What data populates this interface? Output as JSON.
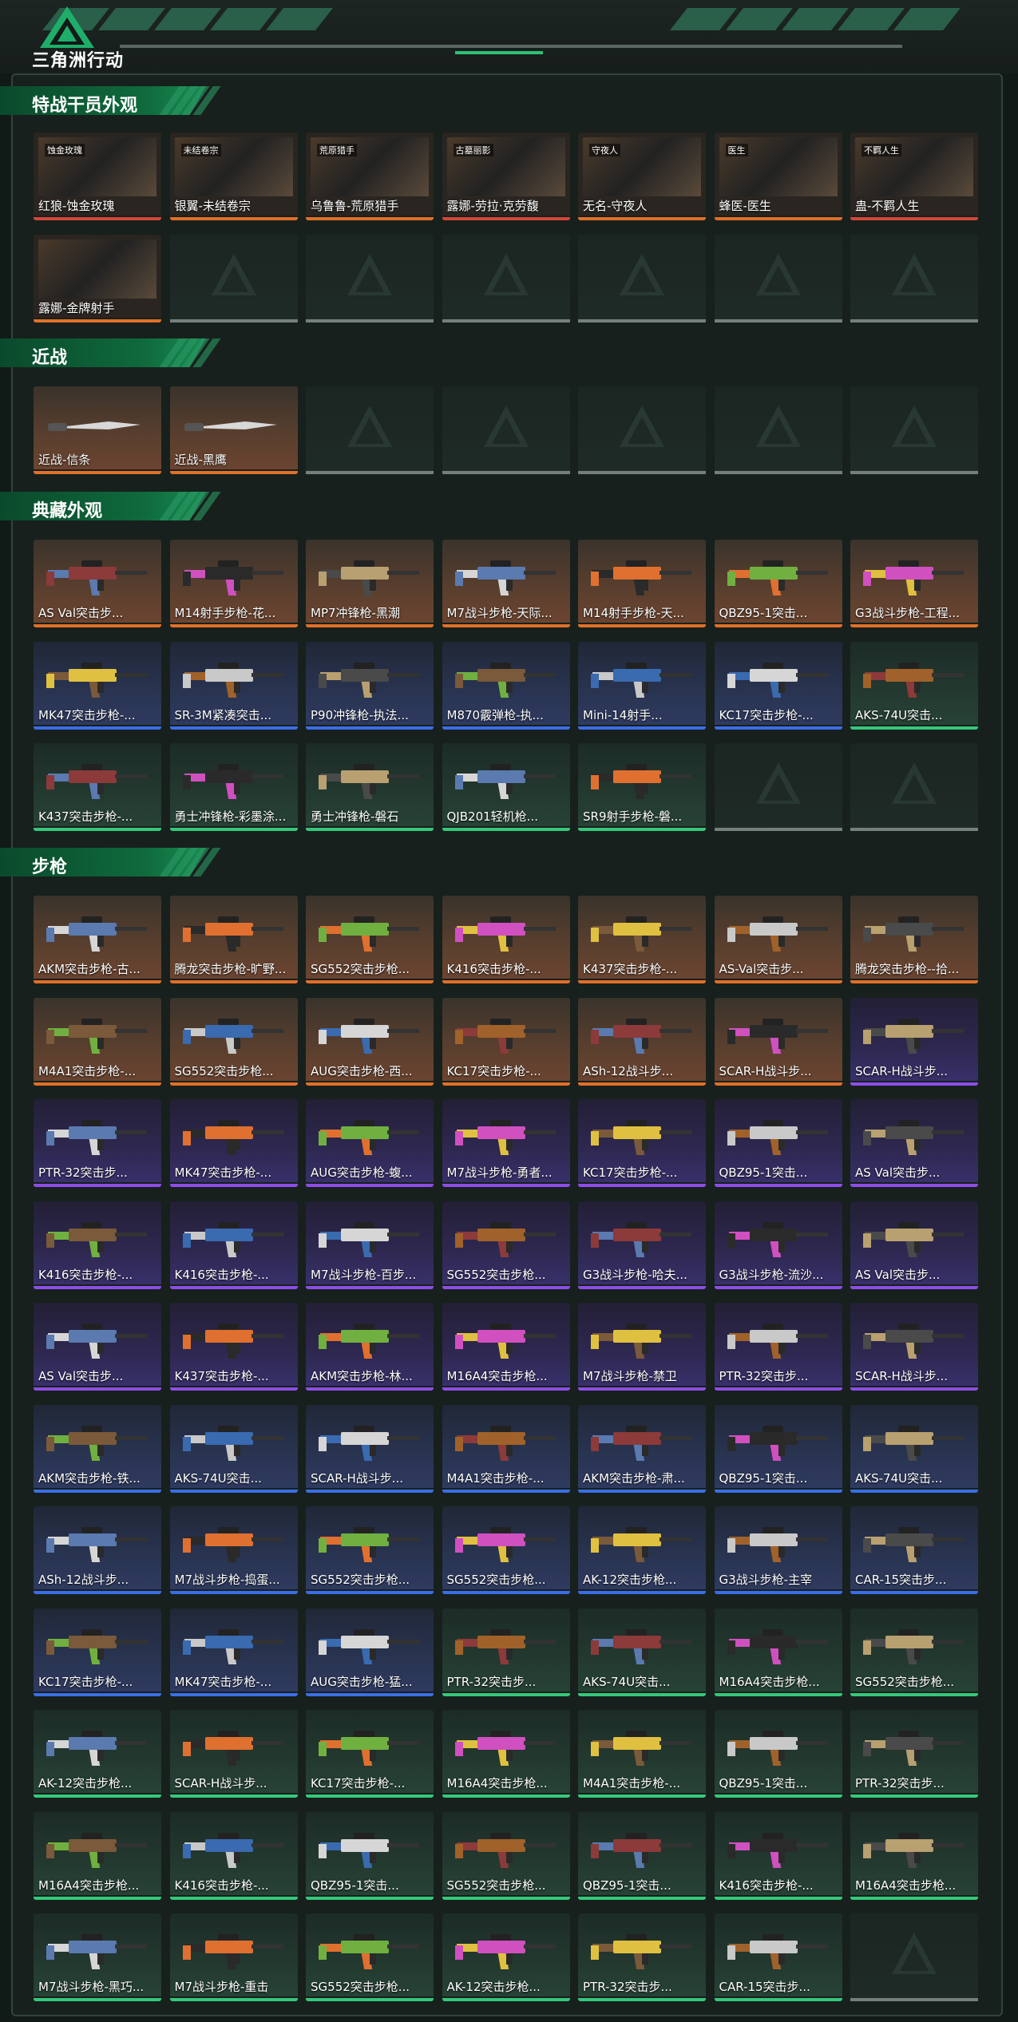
{
  "app": {
    "title": "三角洲行动"
  },
  "sections": [
    {
      "title": "特战干员外观",
      "items": [
        {
          "label": "红狼-蚀金玫瑰",
          "rarity": "red",
          "tag": "蚀金玫瑰"
        },
        {
          "label": "银翼-未结卷宗",
          "rarity": "orange",
          "tag": "未结卷宗"
        },
        {
          "label": "乌鲁鲁-荒原猎手",
          "rarity": "orange",
          "tag": "荒原猎手"
        },
        {
          "label": "露娜-劳拉·克劳馥",
          "rarity": "red",
          "tag": "古墓丽影"
        },
        {
          "label": "无名-守夜人",
          "rarity": "orange",
          "tag": "守夜人"
        },
        {
          "label": "蜂医-医生",
          "rarity": "orange",
          "tag": "医生"
        },
        {
          "label": "蛊-不羁人生",
          "rarity": "red",
          "tag": "不羁人生"
        },
        {
          "label": "露娜-金牌射手",
          "rarity": "orange",
          "tag": ""
        }
      ],
      "empty_slots": 6
    },
    {
      "title": "近战",
      "items": [
        {
          "label": "近战-信条",
          "rarity": "orange"
        },
        {
          "label": "近战-黑鹰",
          "rarity": "orange"
        }
      ],
      "empty_slots": 5
    },
    {
      "title": "典藏外观",
      "items": [
        {
          "label": "AS Val突击步...",
          "rarity": "orange"
        },
        {
          "label": "M14射手步枪-花...",
          "rarity": "orange"
        },
        {
          "label": "MP7冲锋枪-黑潮",
          "rarity": "orange"
        },
        {
          "label": "M7战斗步枪-天际...",
          "rarity": "orange"
        },
        {
          "label": "M14射手步枪-天...",
          "rarity": "orange"
        },
        {
          "label": "QBZ95-1突击...",
          "rarity": "orange"
        },
        {
          "label": "G3战斗步枪-工程...",
          "rarity": "orange"
        },
        {
          "label": "MK47突击步枪-...",
          "rarity": "blue"
        },
        {
          "label": "SR-3M紧凑突击...",
          "rarity": "blue"
        },
        {
          "label": "P90冲锋枪-执法...",
          "rarity": "blue"
        },
        {
          "label": "M870霰弹枪-执...",
          "rarity": "blue"
        },
        {
          "label": "Mini-14射手...",
          "rarity": "blue"
        },
        {
          "label": "KC17突击步枪-...",
          "rarity": "blue"
        },
        {
          "label": "AKS-74U突击...",
          "rarity": "green"
        },
        {
          "label": "K437突击步枪-...",
          "rarity": "green"
        },
        {
          "label": "勇士冲锋枪-彩墨涂...",
          "rarity": "green"
        },
        {
          "label": "勇士冲锋枪-磐石",
          "rarity": "green"
        },
        {
          "label": "QJB201轻机枪...",
          "rarity": "green"
        },
        {
          "label": "SR9射手步枪-磐...",
          "rarity": "green"
        }
      ],
      "empty_slots": 2
    },
    {
      "title": "步枪",
      "items": [
        {
          "label": "AKM突击步枪-古...",
          "rarity": "orange"
        },
        {
          "label": "腾龙突击步枪-旷野...",
          "rarity": "orange"
        },
        {
          "label": "SG552突击步枪...",
          "rarity": "orange"
        },
        {
          "label": "K416突击步枪-...",
          "rarity": "orange"
        },
        {
          "label": "K437突击步枪-...",
          "rarity": "orange"
        },
        {
          "label": "AS-Val突击步...",
          "rarity": "orange"
        },
        {
          "label": "腾龙突击步枪--拾...",
          "rarity": "orange"
        },
        {
          "label": "M4A1突击步枪-...",
          "rarity": "orange"
        },
        {
          "label": "SG552突击步枪...",
          "rarity": "orange"
        },
        {
          "label": "AUG突击步枪-西...",
          "rarity": "orange"
        },
        {
          "label": "KC17突击步枪-...",
          "rarity": "orange"
        },
        {
          "label": "ASh-12战斗步...",
          "rarity": "orange"
        },
        {
          "label": "SCAR-H战斗步...",
          "rarity": "orange"
        },
        {
          "label": "SCAR-H战斗步...",
          "rarity": "purple"
        },
        {
          "label": "PTR-32突击步...",
          "rarity": "purple"
        },
        {
          "label": "MK47突击步枪-...",
          "rarity": "purple"
        },
        {
          "label": "AUG突击步枪-蝮...",
          "rarity": "purple"
        },
        {
          "label": "M7战斗步枪-勇者...",
          "rarity": "purple"
        },
        {
          "label": "KC17突击步枪-...",
          "rarity": "purple"
        },
        {
          "label": "QBZ95-1突击...",
          "rarity": "purple"
        },
        {
          "label": "AS Val突击步...",
          "rarity": "purple"
        },
        {
          "label": "K416突击步枪-...",
          "rarity": "purple"
        },
        {
          "label": "K416突击步枪-...",
          "rarity": "purple"
        },
        {
          "label": "M7战斗步枪-百步...",
          "rarity": "purple"
        },
        {
          "label": "SG552突击步枪...",
          "rarity": "purple"
        },
        {
          "label": "G3战斗步枪-哈夫...",
          "rarity": "purple"
        },
        {
          "label": "G3战斗步枪-流沙...",
          "rarity": "purple"
        },
        {
          "label": "AS Val突击步...",
          "rarity": "purple"
        },
        {
          "label": "AS Val突击步...",
          "rarity": "purple"
        },
        {
          "label": "K437突击步枪-...",
          "rarity": "purple"
        },
        {
          "label": "AKM突击步枪-林...",
          "rarity": "purple"
        },
        {
          "label": "M16A4突击步枪...",
          "rarity": "purple"
        },
        {
          "label": "M7战斗步枪-禁卫",
          "rarity": "purple"
        },
        {
          "label": "PTR-32突击步...",
          "rarity": "purple"
        },
        {
          "label": "SCAR-H战斗步...",
          "rarity": "purple"
        },
        {
          "label": "AKM突击步枪-铁...",
          "rarity": "blue"
        },
        {
          "label": "AKS-74U突击...",
          "rarity": "blue"
        },
        {
          "label": "SCAR-H战斗步...",
          "rarity": "blue"
        },
        {
          "label": "M4A1突击步枪-...",
          "rarity": "blue"
        },
        {
          "label": "AKM突击步枪-肃...",
          "rarity": "blue"
        },
        {
          "label": "QBZ95-1突击...",
          "rarity": "blue"
        },
        {
          "label": "AKS-74U突击...",
          "rarity": "blue"
        },
        {
          "label": "ASh-12战斗步...",
          "rarity": "blue"
        },
        {
          "label": "M7战斗步枪-捣蛋...",
          "rarity": "blue"
        },
        {
          "label": "SG552突击步枪...",
          "rarity": "blue"
        },
        {
          "label": "SG552突击步枪...",
          "rarity": "blue"
        },
        {
          "label": "AK-12突击步枪...",
          "rarity": "blue"
        },
        {
          "label": "G3战斗步枪-主宰",
          "rarity": "blue"
        },
        {
          "label": "CAR-15突击步...",
          "rarity": "blue"
        },
        {
          "label": "KC17突击步枪-...",
          "rarity": "blue"
        },
        {
          "label": "MK47突击步枪-...",
          "rarity": "blue"
        },
        {
          "label": "AUG突击步枪-猛...",
          "rarity": "blue"
        },
        {
          "label": "PTR-32突击步...",
          "rarity": "green"
        },
        {
          "label": "AKS-74U突击...",
          "rarity": "green"
        },
        {
          "label": "M16A4突击步枪...",
          "rarity": "green"
        },
        {
          "label": "SG552突击步枪...",
          "rarity": "green"
        },
        {
          "label": "AK-12突击步枪...",
          "rarity": "green"
        },
        {
          "label": "SCAR-H战斗步...",
          "rarity": "green"
        },
        {
          "label": "KC17突击步枪-...",
          "rarity": "green"
        },
        {
          "label": "M16A4突击步枪...",
          "rarity": "green"
        },
        {
          "label": "M4A1突击步枪-...",
          "rarity": "green"
        },
        {
          "label": "QBZ95-1突击...",
          "rarity": "green"
        },
        {
          "label": "PTR-32突击步...",
          "rarity": "green"
        },
        {
          "label": "M16A4突击步枪...",
          "rarity": "green"
        },
        {
          "label": "K416突击步枪-...",
          "rarity": "green"
        },
        {
          "label": "QBZ95-1突击...",
          "rarity": "green"
        },
        {
          "label": "SG552突击步枪...",
          "rarity": "green"
        },
        {
          "label": "QBZ95-1突击...",
          "rarity": "green"
        },
        {
          "label": "K416突击步枪-...",
          "rarity": "green"
        },
        {
          "label": "M16A4突击步枪...",
          "rarity": "green"
        },
        {
          "label": "M7战斗步枪-黑巧...",
          "rarity": "green"
        },
        {
          "label": "M7战斗步枪-重击",
          "rarity": "green"
        },
        {
          "label": "SG552突击步枪...",
          "rarity": "green"
        },
        {
          "label": "AK-12突击步枪...",
          "rarity": "green"
        },
        {
          "label": "PTR-32突击步...",
          "rarity": "green"
        },
        {
          "label": "CAR-15突击步...",
          "rarity": "green"
        }
      ],
      "empty_slots": 1
    }
  ],
  "colors": {
    "orange": "#e0702a",
    "blue": "#3a6ee8",
    "purple": "#8d4de8",
    "green": "#35c77b",
    "red": "#d3463a",
    "accent": "#1a8a52"
  },
  "icons": {
    "logo": "delta-triangle-logo",
    "weapon": "rifle-icon",
    "empty": "empty-slot-triangle-icon"
  }
}
